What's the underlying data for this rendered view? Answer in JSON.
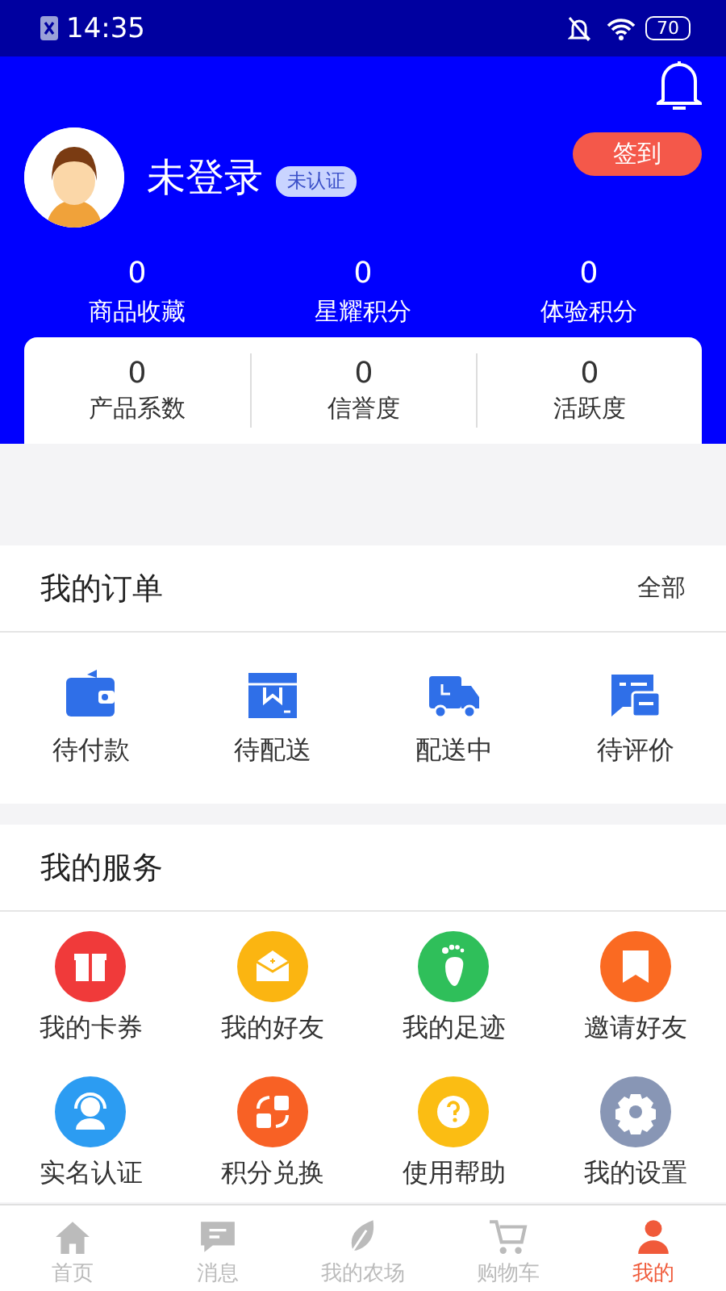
{
  "status_bar": {
    "time": "14:35",
    "battery": "70"
  },
  "profile": {
    "name": "未登录",
    "badge": "未认证",
    "checkin_button": "签到"
  },
  "stats": [
    {
      "value": "0",
      "label": "商品收藏"
    },
    {
      "value": "0",
      "label": "星耀积分"
    },
    {
      "value": "0",
      "label": "体验积分"
    }
  ],
  "card_stats": [
    {
      "value": "0",
      "label": "产品系数"
    },
    {
      "value": "0",
      "label": "信誉度"
    },
    {
      "value": "0",
      "label": "活跃度"
    }
  ],
  "orders": {
    "title": "我的订单",
    "all_link": "全部",
    "items": [
      {
        "label": "待付款"
      },
      {
        "label": "待配送"
      },
      {
        "label": "配送中"
      },
      {
        "label": "待评价"
      }
    ]
  },
  "services": {
    "title": "我的服务",
    "items": [
      {
        "label": "我的卡券",
        "color": "#f03a3a"
      },
      {
        "label": "我的好友",
        "color": "#fbb511"
      },
      {
        "label": "我的足迹",
        "color": "#2fbf5a"
      },
      {
        "label": "邀请好友",
        "color": "#fa6a22"
      },
      {
        "label": "实名认证",
        "color": "#2c9cf2"
      },
      {
        "label": "积分兑换",
        "color": "#f86125"
      },
      {
        "label": "使用帮助",
        "color": "#fbbd13"
      },
      {
        "label": "我的设置",
        "color": "#8896b5"
      }
    ]
  },
  "tabs": [
    {
      "label": "首页",
      "selected": false
    },
    {
      "label": "消息",
      "selected": false
    },
    {
      "label": "我的农场",
      "selected": false
    },
    {
      "label": "购物车",
      "selected": false
    },
    {
      "label": "我的",
      "selected": true
    }
  ]
}
